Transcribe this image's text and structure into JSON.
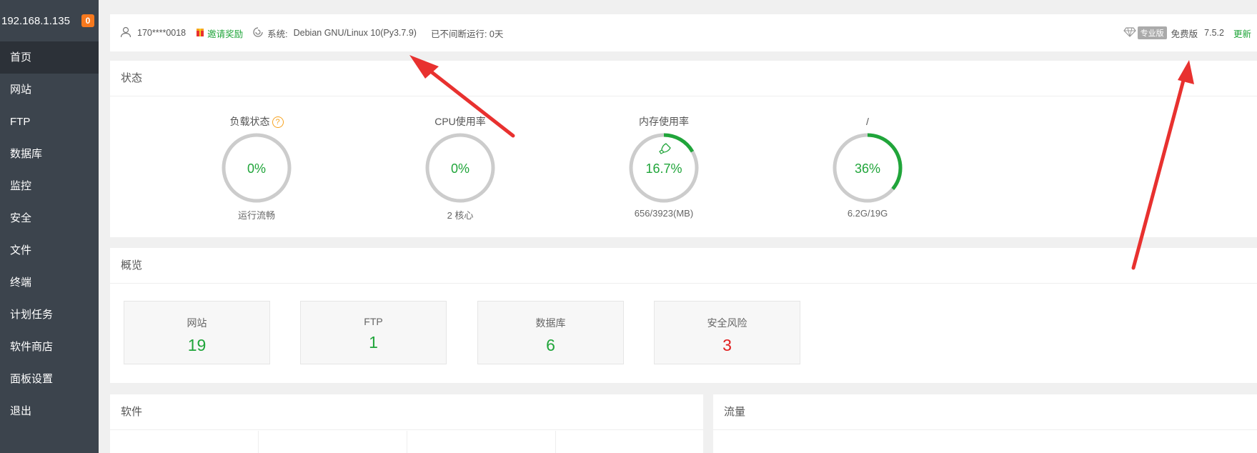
{
  "sidebar": {
    "ip": "192.168.1.135",
    "badge": "0",
    "items": [
      {
        "label": "首页"
      },
      {
        "label": "网站"
      },
      {
        "label": "FTP"
      },
      {
        "label": "数据库"
      },
      {
        "label": "监控"
      },
      {
        "label": "安全"
      },
      {
        "label": "文件"
      },
      {
        "label": "终端"
      },
      {
        "label": "计划任务"
      },
      {
        "label": "软件商店"
      },
      {
        "label": "面板设置"
      },
      {
        "label": "退出"
      }
    ]
  },
  "topbar": {
    "user": "170****0018",
    "invite": "邀请奖励",
    "system_label": "系统:",
    "system_value": "Debian GNU/Linux 10(Py3.7.9)",
    "uptime": "已不间断运行: 0天",
    "pro_badge": "专业版",
    "edition": "免费版",
    "version": "7.5.2",
    "update": "更新"
  },
  "status": {
    "title": "状态",
    "gauges": [
      {
        "label": "负载状态",
        "value": "0%",
        "sub": "运行流畅",
        "pct": 0
      },
      {
        "label": "CPU使用率",
        "value": "0%",
        "sub": "2 核心",
        "pct": 0
      },
      {
        "label": "内存使用率",
        "value": "16.7%",
        "sub": "656/3923(MB)",
        "pct": 16.7
      },
      {
        "label": "/",
        "value": "36%",
        "sub": "6.2G/19G",
        "pct": 36
      }
    ]
  },
  "overview": {
    "title": "概览",
    "cards": [
      {
        "label": "网站",
        "value": "19"
      },
      {
        "label": "FTP",
        "value": "1"
      },
      {
        "label": "数据库",
        "value": "6"
      },
      {
        "label": "安全风险",
        "value": "3"
      }
    ]
  },
  "software": {
    "title": "软件"
  },
  "traffic": {
    "title": "流量"
  },
  "colors": {
    "accent": "#20a53a",
    "risk": "#e01d1d",
    "sidebar": "#3c444d",
    "arrow": "#e8312f"
  }
}
